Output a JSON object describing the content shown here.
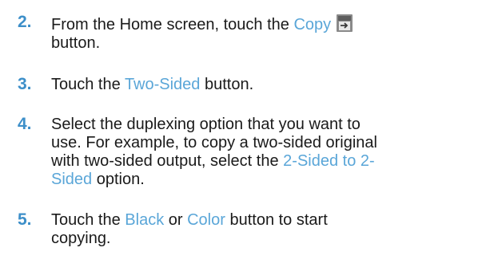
{
  "steps": [
    {
      "number": "2.",
      "line1_pre": "From the Home screen, touch the ",
      "line1_link": "Copy",
      "icon": "copy-icon",
      "line2": "button."
    },
    {
      "number": "3.",
      "pre": "Touch the ",
      "link": "Two-Sided",
      "post": " button."
    },
    {
      "number": "4.",
      "line1": "Select the duplexing option that you want to",
      "line2": "use. For example, to copy a two-sided original",
      "line3_pre": "with two-sided output, select the ",
      "line3_link": "2-Sided to 2-",
      "line4_link": "Sided",
      "line4_post": " option."
    },
    {
      "number": "5.",
      "pre": "Touch the ",
      "link1": "Black",
      "mid": " or ",
      "link2": "Color",
      "post": " button to start",
      "line2": "copying."
    }
  ],
  "colors": {
    "step_number": "#3d8fc9",
    "link": "#5aa6d8",
    "text": "#1a1a1a"
  }
}
